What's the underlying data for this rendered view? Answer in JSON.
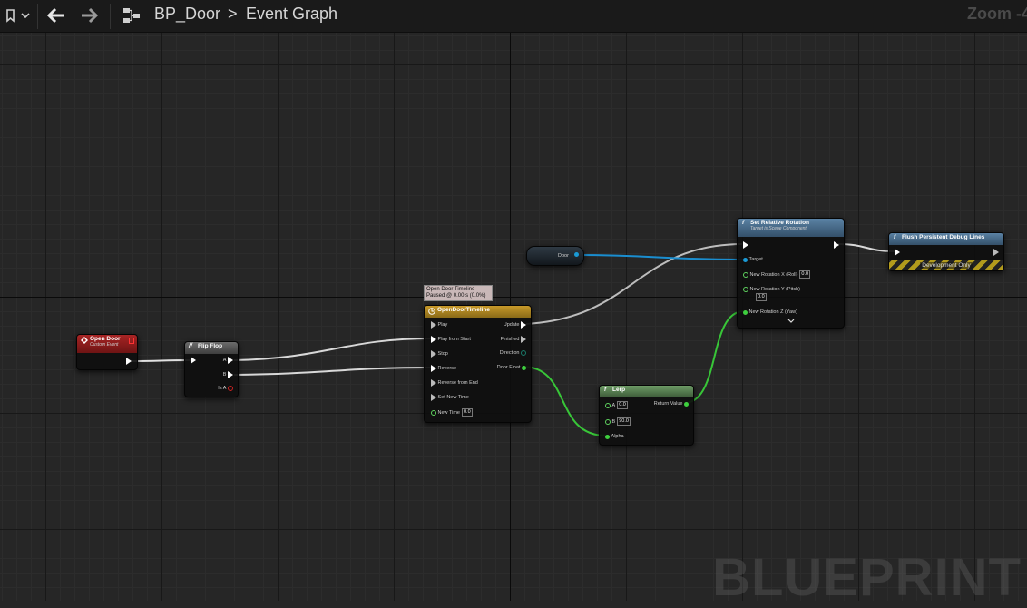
{
  "toolbar": {
    "breadcrumb_root": "BP_Door",
    "breadcrumb_sep": ">",
    "breadcrumb_current": "Event Graph",
    "zoom": "Zoom -4"
  },
  "watermark": "BLUEPRINT",
  "nodes": {
    "open_door": {
      "title": "Open Door",
      "subtitle": "Custom Event"
    },
    "flip_flop": {
      "title": "Flip Flop",
      "pin_a": "A",
      "pin_b": "B",
      "pin_isa": "Is A"
    },
    "door_var": {
      "label": "Door"
    },
    "timeline": {
      "tooltip_line1": "Open Door Timeline",
      "tooltip_line2": "Paused @ 0.00 s (0.0%)",
      "title": "OpenDoorTimeline",
      "in_play": "Play",
      "in_play_from_start": "Play from Start",
      "in_stop": "Stop",
      "in_reverse": "Reverse",
      "in_reverse_from_end": "Reverse from End",
      "in_set_new_time": "Set New Time",
      "in_new_time": "New Time",
      "new_time_value": "0.0",
      "out_update": "Update",
      "out_finished": "Finished",
      "out_direction": "Direction",
      "out_door_float": "Door Float"
    },
    "lerp": {
      "title": "Lerp",
      "pin_a": "A",
      "a_value": "0.0",
      "pin_b": "B",
      "b_value": "90.0",
      "pin_alpha": "Alpha",
      "out_return": "Return Value"
    },
    "set_rotation": {
      "title": "Set Relative Rotation",
      "subtitle": "Target is Scene Component",
      "pin_target": "Target",
      "pin_roll": "New Rotation X (Roll)",
      "roll_value": "0.0",
      "pin_pitch": "New Rotation Y (Pitch)",
      "pitch_value": "0.0",
      "pin_yaw": "New Rotation Z (Yaw)"
    },
    "flush": {
      "title": "Flush Persistent Debug Lines",
      "dev_only": "Development Only"
    }
  },
  "colors": {
    "event_header": "#8c1e1e",
    "flipflop_header": "#5a5a5a",
    "timeline_header": "#b58a22",
    "lerp_header": "#5f8a5a",
    "function_header": "#4a6f8e",
    "exec_wire": "#e6e6e6",
    "float_wire": "#3ecf3e",
    "object_wire": "#1a9ad6"
  }
}
